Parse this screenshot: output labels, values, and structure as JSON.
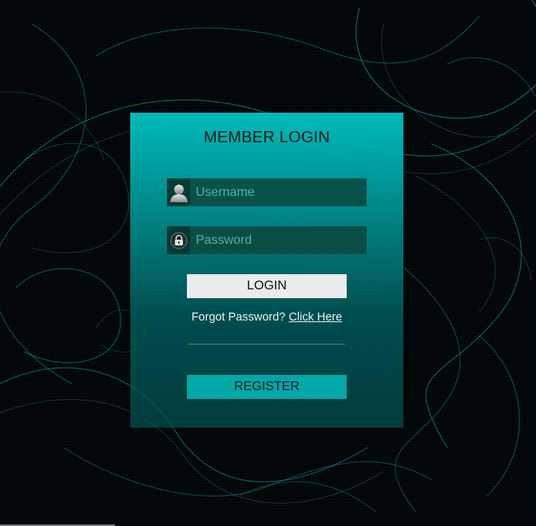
{
  "login_card": {
    "title": "MEMBER LOGIN",
    "username": {
      "placeholder": "Username",
      "icon": "user-icon"
    },
    "password": {
      "placeholder": "Password",
      "icon": "lock-icon"
    },
    "login_label": "LOGIN",
    "forgot_text": "Forgot Password?",
    "forgot_link": "Click Here",
    "register_label": "REGISTER"
  },
  "colors": {
    "background": "#020506",
    "card_top": "#00c4c4",
    "card_bottom": "#005050",
    "field_bg": "#0a463c",
    "login_button": "#ecebec",
    "register_button": "#04a7a7"
  }
}
